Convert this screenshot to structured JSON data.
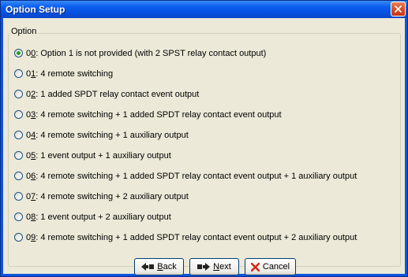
{
  "window": {
    "title": "Option Setup"
  },
  "group": {
    "label": "Option"
  },
  "options": [
    {
      "code_prefix": "0",
      "code_accel": "0",
      "text": ": Option 1 is not provided (with 2 SPST relay contact output)",
      "checked": true
    },
    {
      "code_prefix": "0",
      "code_accel": "1",
      "text": ": 4 remote switching",
      "checked": false
    },
    {
      "code_prefix": "0",
      "code_accel": "2",
      "text": ": 1 added SPDT relay contact event output",
      "checked": false
    },
    {
      "code_prefix": "0",
      "code_accel": "3",
      "text": ": 4 remote switching + 1 added SPDT relay contact event output",
      "checked": false
    },
    {
      "code_prefix": "0",
      "code_accel": "4",
      "text": ": 4 remote switching + 1 auxiliary output",
      "checked": false
    },
    {
      "code_prefix": "0",
      "code_accel": "5",
      "text": ": 1 event output + 1 auxiliary output",
      "checked": false
    },
    {
      "code_prefix": "0",
      "code_accel": "6",
      "text": ": 4 remote switching + 1 added SPDT relay contact event output + 1 auxiliary output",
      "checked": false
    },
    {
      "code_prefix": "0",
      "code_accel": "7",
      "text": ": 4 remote switching + 2 auxiliary output",
      "checked": false
    },
    {
      "code_prefix": "0",
      "code_accel": "8",
      "text": ": 1 event output + 2 auxiliary output",
      "checked": false
    },
    {
      "code_prefix": "0",
      "code_accel": "9",
      "text": ": 4 remote switching + 1 added SPDT relay contact event output + 2 auxiliary output",
      "checked": false
    }
  ],
  "buttons": {
    "back": {
      "accel": "B",
      "rest": "ack",
      "icon": "back-arrow-icon"
    },
    "next": {
      "accel": "N",
      "rest": "ext",
      "icon": "next-arrow-icon"
    },
    "cancel": {
      "label": "Cancel",
      "icon": "red-x-icon"
    }
  },
  "colors": {
    "title_bar": "#0a5ef0",
    "dialog_bg": "#ece9d8",
    "close_button": "#d6461d",
    "radio_dot": "#21a121",
    "cancel_icon": "#d42a1a"
  }
}
